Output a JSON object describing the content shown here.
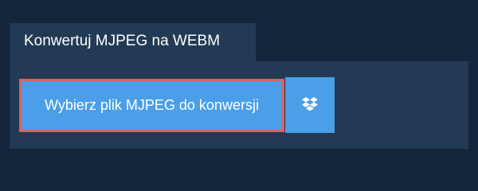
{
  "tab": {
    "label": "Konwertuj MJPEG na WEBM"
  },
  "actions": {
    "select_file_label": "Wybierz plik MJPEG do konwersji",
    "dropbox_icon": "dropbox-icon"
  },
  "colors": {
    "background": "#13253b",
    "panel": "#223a53",
    "button": "#4a9fe8",
    "highlight_border": "#e0605a",
    "text": "#ffffff"
  }
}
